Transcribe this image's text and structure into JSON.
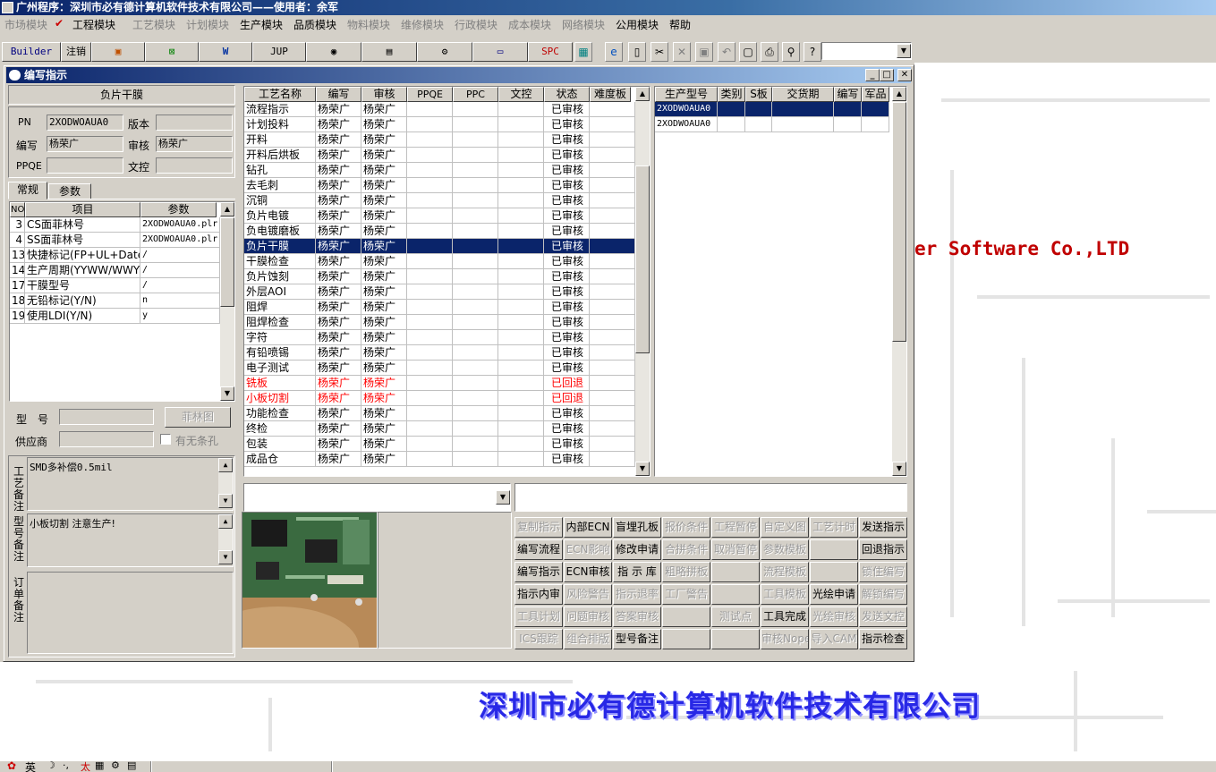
{
  "app": {
    "title": "广州程序：深圳市必有德计算机软件技术有限公司——使用者：余军",
    "brand_en": "er Software Co.,LTD",
    "brand_cn": "深圳市必有德计算机软件技术有限公司"
  },
  "menu": [
    {
      "label": "市场模块",
      "enabled": false
    },
    {
      "label": "工程模块",
      "enabled": true,
      "checked": true
    },
    {
      "label": "工艺模块",
      "enabled": false
    },
    {
      "label": "计划模块",
      "enabled": false
    },
    {
      "label": "生产模块",
      "enabled": true
    },
    {
      "label": "品质模块",
      "enabled": true
    },
    {
      "label": "物料模块",
      "enabled": false
    },
    {
      "label": "维修模块",
      "enabled": false
    },
    {
      "label": "行政模块",
      "enabled": false
    },
    {
      "label": "成本模块",
      "enabled": false
    },
    {
      "label": "网络模块",
      "enabled": false
    },
    {
      "label": "公用模块",
      "enabled": true
    },
    {
      "label": "帮助",
      "enabled": true
    }
  ],
  "toolbar": {
    "builder": "Builder",
    "logout": "注销",
    "jup": "JUP",
    "spc": "SPC"
  },
  "window": {
    "title": "编写指示",
    "product_name": "负片干膜",
    "pn_label": "PN",
    "pn_value": "2XODWOAUA0",
    "version_label": "版本",
    "version_value": "",
    "author_label": "编写",
    "author_value": "杨荣广",
    "reviewer_label": "审核",
    "reviewer_value": "杨荣广",
    "ppqe_label": "PPQE",
    "ppqe_value": "",
    "doc_label": "文控",
    "doc_value": ""
  },
  "tabs": [
    "常规",
    "参数"
  ],
  "params": {
    "headers": [
      "NO",
      "项目",
      "参数"
    ],
    "rows": [
      {
        "no": "3",
        "item": "CS面菲林号",
        "value": "2XODWOAUA0.plr"
      },
      {
        "no": "4",
        "item": "SS面菲林号",
        "value": "2XODWOAUA0.plr"
      },
      {
        "no": "13",
        "item": "快捷标记(FP+UL+DateC",
        "value": "/"
      },
      {
        "no": "14",
        "item": "生产周期(YYWW/WWYY)",
        "value": "/"
      },
      {
        "no": "17",
        "item": "干膜型号",
        "value": "/"
      },
      {
        "no": "18",
        "item": "无铅标记(Y/N)",
        "value": "n"
      },
      {
        "no": "19",
        "item": "使用LDI(Y/N)",
        "value": "y"
      }
    ]
  },
  "form2": {
    "model_label": "型　号",
    "model_value": "",
    "film_button": "菲林图",
    "supplier_label": "供应商",
    "supplier_value": "",
    "slot_checkbox": "有无条孔",
    "process_note_label": "工艺备注",
    "process_note": "SMD多补偿0.5mil",
    "model_note_label": "型号备注",
    "model_note": "小板切割 注意生产!",
    "order_note_label": "订单备注",
    "order_note": ""
  },
  "process": {
    "headers": [
      "工艺名称",
      "编写",
      "审核",
      "PPQE",
      "PPC",
      "文控",
      "状态",
      "难度板"
    ],
    "rows": [
      {
        "name": "流程指示",
        "author": "杨荣广",
        "reviewer": "杨荣广",
        "status": "已审核"
      },
      {
        "name": "计划投料",
        "author": "杨荣广",
        "reviewer": "杨荣广",
        "status": "已审核"
      },
      {
        "name": "开料",
        "author": "杨荣广",
        "reviewer": "杨荣广",
        "status": "已审核"
      },
      {
        "name": "开料后烘板",
        "author": "杨荣广",
        "reviewer": "杨荣广",
        "status": "已审核"
      },
      {
        "name": "钻孔",
        "author": "杨荣广",
        "reviewer": "杨荣广",
        "status": "已审核"
      },
      {
        "name": "去毛刺",
        "author": "杨荣广",
        "reviewer": "杨荣广",
        "status": "已审核"
      },
      {
        "name": "沉铜",
        "author": "杨荣广",
        "reviewer": "杨荣广",
        "status": "已审核"
      },
      {
        "name": "负片电镀",
        "author": "杨荣广",
        "reviewer": "杨荣广",
        "status": "已审核"
      },
      {
        "name": "负电镀磨板",
        "author": "杨荣广",
        "reviewer": "杨荣广",
        "status": "已审核"
      },
      {
        "name": "负片干膜",
        "author": "杨荣广",
        "reviewer": "杨荣广",
        "status": "已审核",
        "selected": true
      },
      {
        "name": "干膜检查",
        "author": "杨荣广",
        "reviewer": "杨荣广",
        "status": "已审核"
      },
      {
        "name": "负片蚀刻",
        "author": "杨荣广",
        "reviewer": "杨荣广",
        "status": "已审核"
      },
      {
        "name": "外层AOI",
        "author": "杨荣广",
        "reviewer": "杨荣广",
        "status": "已审核"
      },
      {
        "name": "阻焊",
        "author": "杨荣广",
        "reviewer": "杨荣广",
        "status": "已审核"
      },
      {
        "name": "阻焊检查",
        "author": "杨荣广",
        "reviewer": "杨荣广",
        "status": "已审核"
      },
      {
        "name": "字符",
        "author": "杨荣广",
        "reviewer": "杨荣广",
        "status": "已审核"
      },
      {
        "name": "有铅喷锡",
        "author": "杨荣广",
        "reviewer": "杨荣广",
        "status": "已审核"
      },
      {
        "name": "电子测试",
        "author": "杨荣广",
        "reviewer": "杨荣广",
        "status": "已审核"
      },
      {
        "name": "铣板",
        "author": "杨荣广",
        "reviewer": "杨荣广",
        "status": "已回退",
        "returned": true
      },
      {
        "name": "小板切割",
        "author": "杨荣广",
        "reviewer": "杨荣广",
        "status": "已回退",
        "returned": true
      },
      {
        "name": "功能检查",
        "author": "杨荣广",
        "reviewer": "杨荣广",
        "status": "已审核"
      },
      {
        "name": "终检",
        "author": "杨荣广",
        "reviewer": "杨荣广",
        "status": "已审核"
      },
      {
        "name": "包装",
        "author": "杨荣广",
        "reviewer": "杨荣广",
        "status": "已审核"
      },
      {
        "name": "成品仓",
        "author": "杨荣广",
        "reviewer": "杨荣广",
        "status": "已审核"
      }
    ]
  },
  "models": {
    "headers": [
      "生产型号",
      "类别",
      "S板",
      "交货期",
      "编写",
      "军品"
    ],
    "rows": [
      {
        "model": "2XODWOAUA0",
        "selected": true
      },
      {
        "model": "2XODWOAUA0",
        "selected": false
      }
    ]
  },
  "actions": [
    [
      {
        "label": "复制指示",
        "enabled": false
      },
      {
        "label": "内部ECN",
        "enabled": true
      },
      {
        "label": "盲埋孔板",
        "enabled": true
      },
      {
        "label": "报价条件",
        "enabled": false
      },
      {
        "label": "工程暂停",
        "enabled": false
      },
      {
        "label": "自定义图",
        "enabled": false
      },
      {
        "label": "工艺计时",
        "enabled": false
      },
      {
        "label": "发送指示",
        "enabled": true
      }
    ],
    [
      {
        "label": "编写流程",
        "enabled": true
      },
      {
        "label": "ECN影响",
        "enabled": false
      },
      {
        "label": "修改申请",
        "enabled": true
      },
      {
        "label": "合拼条件",
        "enabled": false
      },
      {
        "label": "取消暂停",
        "enabled": false
      },
      {
        "label": "参数模板",
        "enabled": false
      },
      {
        "label": "",
        "enabled": false
      },
      {
        "label": "回退指示",
        "enabled": true
      }
    ],
    [
      {
        "label": "编写指示",
        "enabled": true
      },
      {
        "label": "ECN审核",
        "enabled": true
      },
      {
        "label": "指 示 库",
        "enabled": true
      },
      {
        "label": "粗略拼板",
        "enabled": false
      },
      {
        "label": "",
        "enabled": false
      },
      {
        "label": "流程模板",
        "enabled": false
      },
      {
        "label": "",
        "enabled": false
      },
      {
        "label": "锁住编写",
        "enabled": false
      }
    ],
    [
      {
        "label": "指示内审",
        "enabled": true
      },
      {
        "label": "风险警告",
        "enabled": false
      },
      {
        "label": "指示退率",
        "enabled": false
      },
      {
        "label": "工厂警告",
        "enabled": false
      },
      {
        "label": "",
        "enabled": false
      },
      {
        "label": "工具模板",
        "enabled": false
      },
      {
        "label": "光绘申请",
        "enabled": true
      },
      {
        "label": "解锁编写",
        "enabled": false
      }
    ],
    [
      {
        "label": "工具计划",
        "enabled": false
      },
      {
        "label": "问题审核",
        "enabled": false
      },
      {
        "label": "答案审核",
        "enabled": false
      },
      {
        "label": "",
        "enabled": false
      },
      {
        "label": "测试点",
        "enabled": false
      },
      {
        "label": "工具完成",
        "enabled": true
      },
      {
        "label": "光绘审核",
        "enabled": false
      },
      {
        "label": "发送文控",
        "enabled": false
      }
    ],
    [
      {
        "label": "ICS跟踪",
        "enabled": false
      },
      {
        "label": "组合排版",
        "enabled": false
      },
      {
        "label": "型号备注",
        "enabled": true
      },
      {
        "label": "",
        "enabled": false
      },
      {
        "label": "",
        "enabled": false
      },
      {
        "label": "审核Nope",
        "enabled": false
      },
      {
        "label": "导入CAM",
        "enabled": false
      },
      {
        "label": "指示检查",
        "enabled": true
      }
    ]
  ],
  "taskbar": {
    "ime": "英"
  }
}
